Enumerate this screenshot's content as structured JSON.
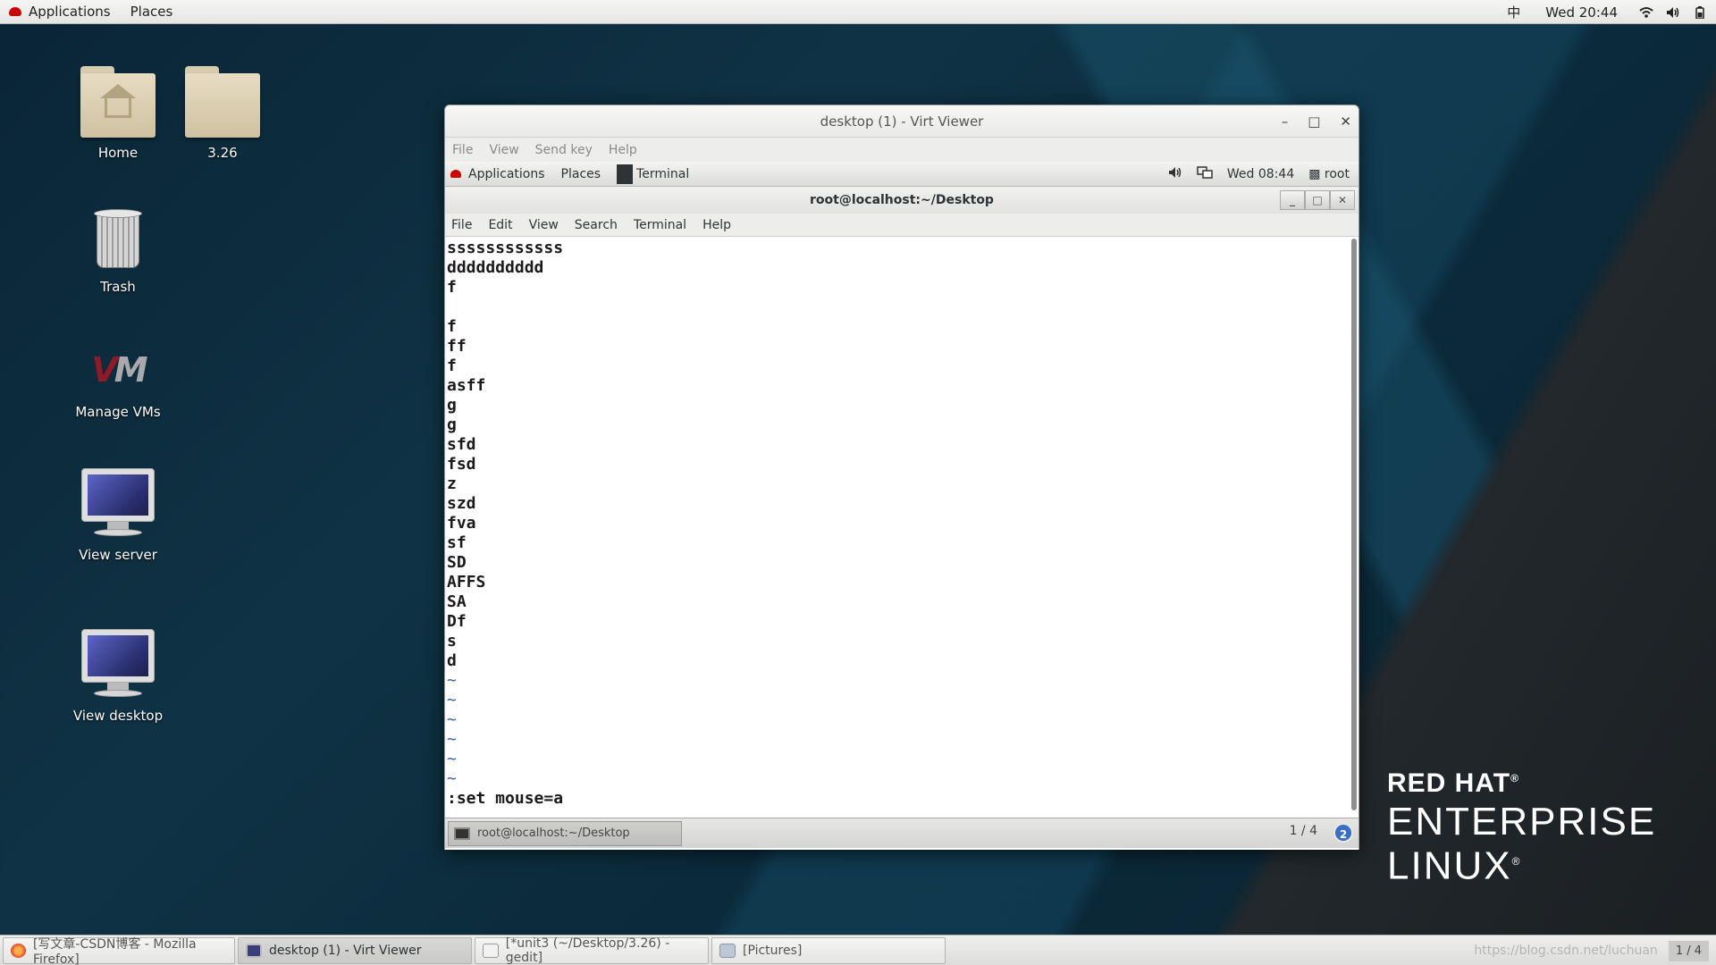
{
  "topbar": {
    "applications": "Applications",
    "places": "Places",
    "input_method": "中",
    "clock": "Wed 20:44",
    "icons": [
      "wifi-icon",
      "volume-icon",
      "battery-icon"
    ]
  },
  "desktop": {
    "icons": [
      {
        "label": "Home",
        "icon": "home-folder-icon"
      },
      {
        "label": "3.26",
        "icon": "folder-icon"
      },
      {
        "label": "Trash",
        "icon": "trash-icon"
      },
      {
        "label": "Manage VMs",
        "icon": "vm-logo-icon"
      },
      {
        "label": "View server",
        "icon": "monitor-icon"
      },
      {
        "label": "View desktop",
        "icon": "monitor-icon"
      }
    ],
    "branding": {
      "line1": "RED HAT",
      "line2": "ENTERPRISE",
      "line3": "LINUX",
      "mark": "®"
    }
  },
  "virt_viewer": {
    "title": "desktop (1) - Virt Viewer",
    "menu": [
      "File",
      "View",
      "Send key",
      "Help"
    ],
    "guest_topbar": {
      "applications": "Applications",
      "places": "Places",
      "terminal": "Terminal",
      "clock": "Wed 08:44",
      "user": "root"
    },
    "terminal": {
      "title": "root@localhost:~/Desktop",
      "menu": [
        "File",
        "Edit",
        "View",
        "Search",
        "Terminal",
        "Help"
      ],
      "lines": [
        "ssssssssssss",
        "dddddddddd",
        "f",
        "",
        "f",
        "ff",
        "f",
        "asff",
        "g",
        "g",
        "sfd",
        "fsd",
        "z",
        "szd",
        "fva",
        "sf",
        "SD",
        "AFFS",
        "SA",
        "Df",
        "s",
        "d",
        "~",
        "~",
        "~",
        "~",
        "~",
        "~"
      ],
      "command": ":set mouse=a"
    },
    "guest_taskbar": {
      "task": "root@localhost:~/Desktop",
      "pager": "1 / 4",
      "badge": "2"
    }
  },
  "taskbar": {
    "tasks": [
      {
        "label": "[写文章-CSDN博客 - Mozilla Firefox]",
        "icon": "firefox-icon"
      },
      {
        "label": "desktop (1) - Virt Viewer",
        "icon": "monitor-icon"
      },
      {
        "label": "[*unit3 (~/Desktop/3.26) - gedit]",
        "icon": "gedit-icon"
      },
      {
        "label": "[Pictures]",
        "icon": "file-manager-icon"
      }
    ],
    "watermark": "https://blog.csdn.net/luchuan",
    "pager": "1 / 4"
  }
}
